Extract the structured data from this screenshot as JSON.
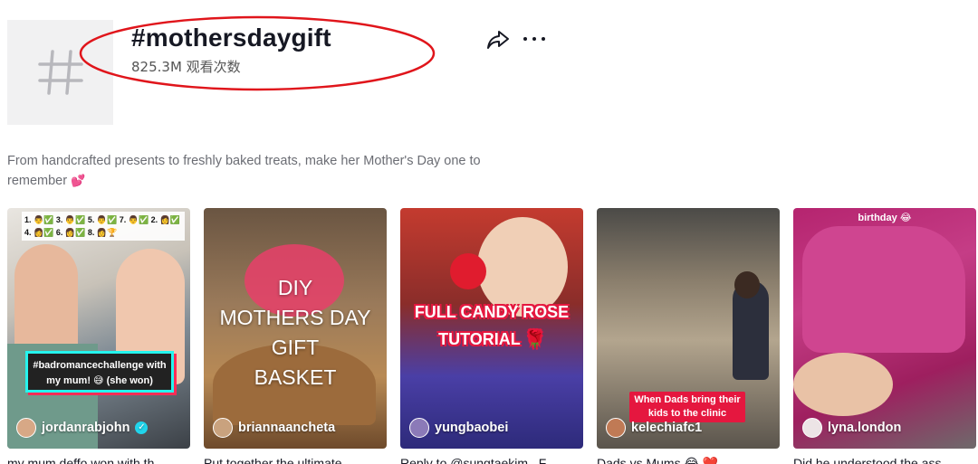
{
  "header": {
    "title": "#mothersdaygift",
    "views": "825.3M 观看次数",
    "icon": "hashtag-icon"
  },
  "description": {
    "text": "From handcrafted presents to freshly baked treats, make her Mother's Day one to remember",
    "emoji": "💕"
  },
  "actions": {
    "share_icon": "share-icon",
    "more_icon": "more-icon"
  },
  "videos": [
    {
      "author": "jordanrabjohn",
      "verified": true,
      "caption": "my mum deffo won with th",
      "overlay_text": "#badromancechallenge with my mum! 😅 (she won)",
      "ranking_text": "1. 👨✅ 3. 👨✅ 5. 👨✅ 7. 👨✅ 2. 👩✅ 4. 👩✅ 6. 👩✅ 8. 👩🏆"
    },
    {
      "author": "briannaancheta",
      "verified": false,
      "caption": "Put together the ultimate",
      "overlay_lines": [
        "DIY",
        "MOTHERS DAY",
        "GIFT",
        "BASKET"
      ]
    },
    {
      "author": "yungbaobei",
      "verified": false,
      "caption": "Reply to @sungtaekim . F",
      "overlay_lines": [
        "FULL CANDY ROSE",
        "TUTORIAL 🌹"
      ]
    },
    {
      "author": "kelechiafc1",
      "verified": false,
      "caption": "Dads vs Mums 😂 ❤️",
      "overlay_text": "When Dads bring their kids to the clinic"
    },
    {
      "author": "lyna.london",
      "verified": false,
      "caption": "Did he understood the ass",
      "overlay_text": "birthday 😂"
    }
  ],
  "colors": {
    "annotation": "#e0151b",
    "text_primary": "#161823",
    "text_secondary": "#6b6d74"
  }
}
